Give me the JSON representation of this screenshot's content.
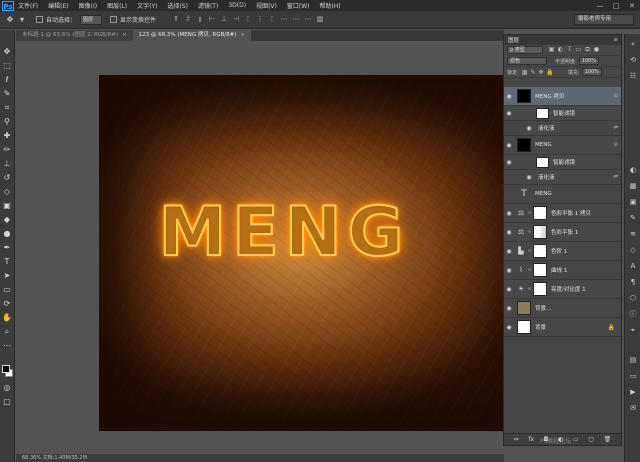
{
  "app": {
    "logo": "Ps",
    "window_controls": [
      "—",
      "□",
      "✕"
    ]
  },
  "menus": [
    "文件(F)",
    "编辑(E)",
    "图像(I)",
    "图层(L)",
    "文字(Y)",
    "选择(S)",
    "滤镜(T)",
    "3D(D)",
    "视图(V)",
    "窗口(W)",
    "帮助(H)"
  ],
  "options_bar": {
    "auto_select_label": "自动选择：",
    "auto_select_value": "图层",
    "show_transform_label": "显示变换控件",
    "workspace": "摄影老师专用"
  },
  "tabs": [
    {
      "label": "未标题-1 @ 63.6% (图层 2, RGB/8#)",
      "close": "×",
      "active": false
    },
    {
      "label": "123 @ 68.3% (MENG 拷贝, RGB/8#)",
      "close": "×",
      "active": true
    }
  ],
  "canvas": {
    "text": "MENG"
  },
  "layers_panel": {
    "title": "图层",
    "menu_icon": "≡",
    "filter_kind": "ρ 类型",
    "blend_mode": "滤色",
    "opacity_label": "不透明度:",
    "opacity_value": "100%",
    "lock_label": "锁定:",
    "fill_label": "填充:",
    "fill_value": "100%",
    "layers": [
      {
        "name": "MENG 拷贝",
        "kind": "smart",
        "selected": true,
        "fx": "⊙"
      },
      {
        "name": "智能滤镜",
        "kind": "smartfilter-mask"
      },
      {
        "name": "液化液",
        "kind": "smartfilter-item"
      },
      {
        "name": "MENG",
        "kind": "smart",
        "selected": false,
        "fx": "⊙"
      },
      {
        "name": "智能滤镜",
        "kind": "smartfilter-mask"
      },
      {
        "name": "液化液",
        "kind": "smartfilter-item"
      },
      {
        "name": "MENG",
        "kind": "text"
      },
      {
        "name": "色彩平衡 1 拷贝",
        "kind": "adjust",
        "icon": "⚖"
      },
      {
        "name": "色彩平衡 1",
        "kind": "adjust",
        "icon": "⚖"
      },
      {
        "name": "色阶 1",
        "kind": "adjust",
        "icon": "▙"
      },
      {
        "name": "曲线 1",
        "kind": "adjust",
        "icon": "⌇"
      },
      {
        "name": "亮度/对比度 1",
        "kind": "adjust",
        "icon": "☀"
      },
      {
        "name": "背景...",
        "kind": "texture"
      },
      {
        "name": "背景",
        "kind": "background",
        "lock": "🔒"
      }
    ],
    "footer_icons": [
      "⇔",
      "fx",
      "◘",
      "◐",
      "▭",
      "▢",
      "🗑"
    ]
  },
  "status_bar": "68.36%     文档:1.40M/35.2M",
  "watermark": "PS教程论坛"
}
